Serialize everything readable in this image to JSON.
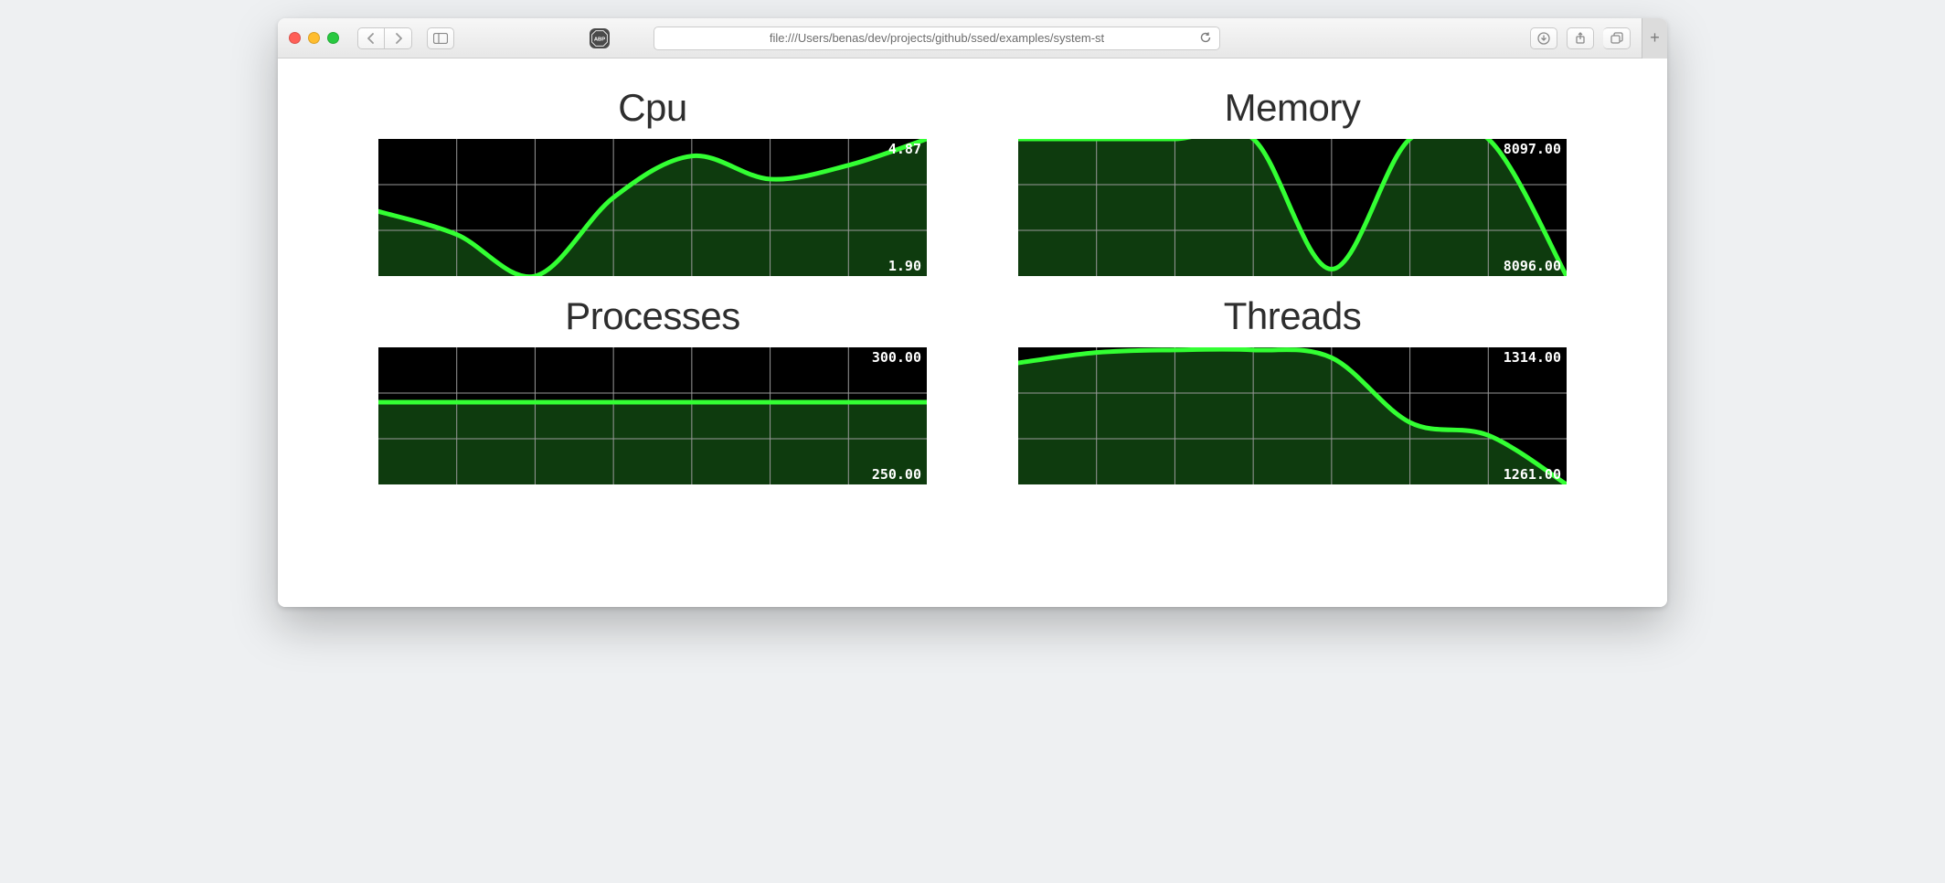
{
  "browser": {
    "url": "file:///Users/benas/dev/projects/github/ssed/examples/system-st",
    "abp_label": "ABP"
  },
  "colors": {
    "line": "#33ff33",
    "fill": "#0e3b0e",
    "grid": "#999999",
    "bg": "#000000"
  },
  "chart_data": [
    {
      "id": "cpu",
      "type": "area",
      "title": "Cpu",
      "ylim": [
        1.9,
        4.87
      ],
      "max_label": "4.87",
      "min_label": "1.90",
      "x": [
        0,
        1,
        2,
        3,
        4,
        5,
        6,
        7
      ],
      "values": [
        3.3,
        2.8,
        1.9,
        3.6,
        4.5,
        4.0,
        4.3,
        4.87
      ]
    },
    {
      "id": "memory",
      "type": "area",
      "title": "Memory",
      "ylim": [
        8096.0,
        8097.0
      ],
      "max_label": "8097.00",
      "min_label": "8096.00",
      "x": [
        0,
        1,
        2,
        3,
        4,
        5,
        6,
        7
      ],
      "values": [
        8097.0,
        8097.0,
        8097.0,
        8097.0,
        8096.05,
        8097.0,
        8097.0,
        8096.0
      ]
    },
    {
      "id": "processes",
      "type": "area",
      "title": "Processes",
      "ylim": [
        250.0,
        300.0
      ],
      "max_label": "300.00",
      "min_label": "250.00",
      "x": [
        0,
        1,
        2,
        3,
        4,
        5,
        6,
        7
      ],
      "values": [
        280,
        280,
        280,
        280,
        280,
        280,
        280,
        280
      ]
    },
    {
      "id": "threads",
      "type": "area",
      "title": "Threads",
      "ylim": [
        1261.0,
        1314.0
      ],
      "max_label": "1314.00",
      "min_label": "1261.00",
      "x": [
        0,
        1,
        2,
        3,
        4,
        5,
        6,
        7
      ],
      "values": [
        1308,
        1312,
        1313,
        1313,
        1310,
        1285,
        1280,
        1261
      ]
    }
  ]
}
